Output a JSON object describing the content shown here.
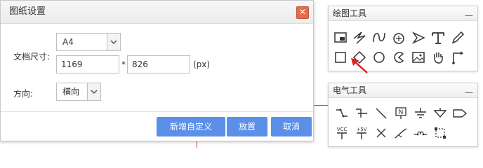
{
  "dialog": {
    "title": "图纸设置",
    "doc_size_label": "文档尺寸:",
    "paper_size_value": "A4",
    "width_value": "1169",
    "height_value": "826",
    "multiply_symbol": "*",
    "unit_label": "(px)",
    "direction_label": "方向:",
    "orientation_value": "横向",
    "buttons": {
      "add_custom": "新增自定义",
      "place": "放置",
      "cancel": "取消"
    }
  },
  "draw_tools_panel": {
    "title": "绘图工具",
    "minimize_symbol": "—",
    "tools": [
      "rectangle-frame-icon",
      "lightning-icon",
      "curve-icon",
      "circle-arrow-icon",
      "arrow-head-icon",
      "text-icon",
      "pencil-icon",
      "square-icon",
      "diamond-icon",
      "circle-icon",
      "pacman-icon",
      "image-icon",
      "hand-icon",
      "connector-icon"
    ]
  },
  "electric_tools_panel": {
    "title": "电气工具",
    "minimize_symbol": "—",
    "labels": {
      "vcc": "VCC",
      "plus5v": "+5V",
      "n_box": "N"
    },
    "tools": [
      "switch-icon",
      "switch-t-icon",
      "slash-icon",
      "n-box-icon",
      "ground-icon",
      "triangle-down-icon",
      "tag-icon",
      "vcc-icon",
      "plus5v-icon",
      "cross-icon",
      "probe-icon",
      "coil-icon",
      "grid-icon"
    ]
  }
}
